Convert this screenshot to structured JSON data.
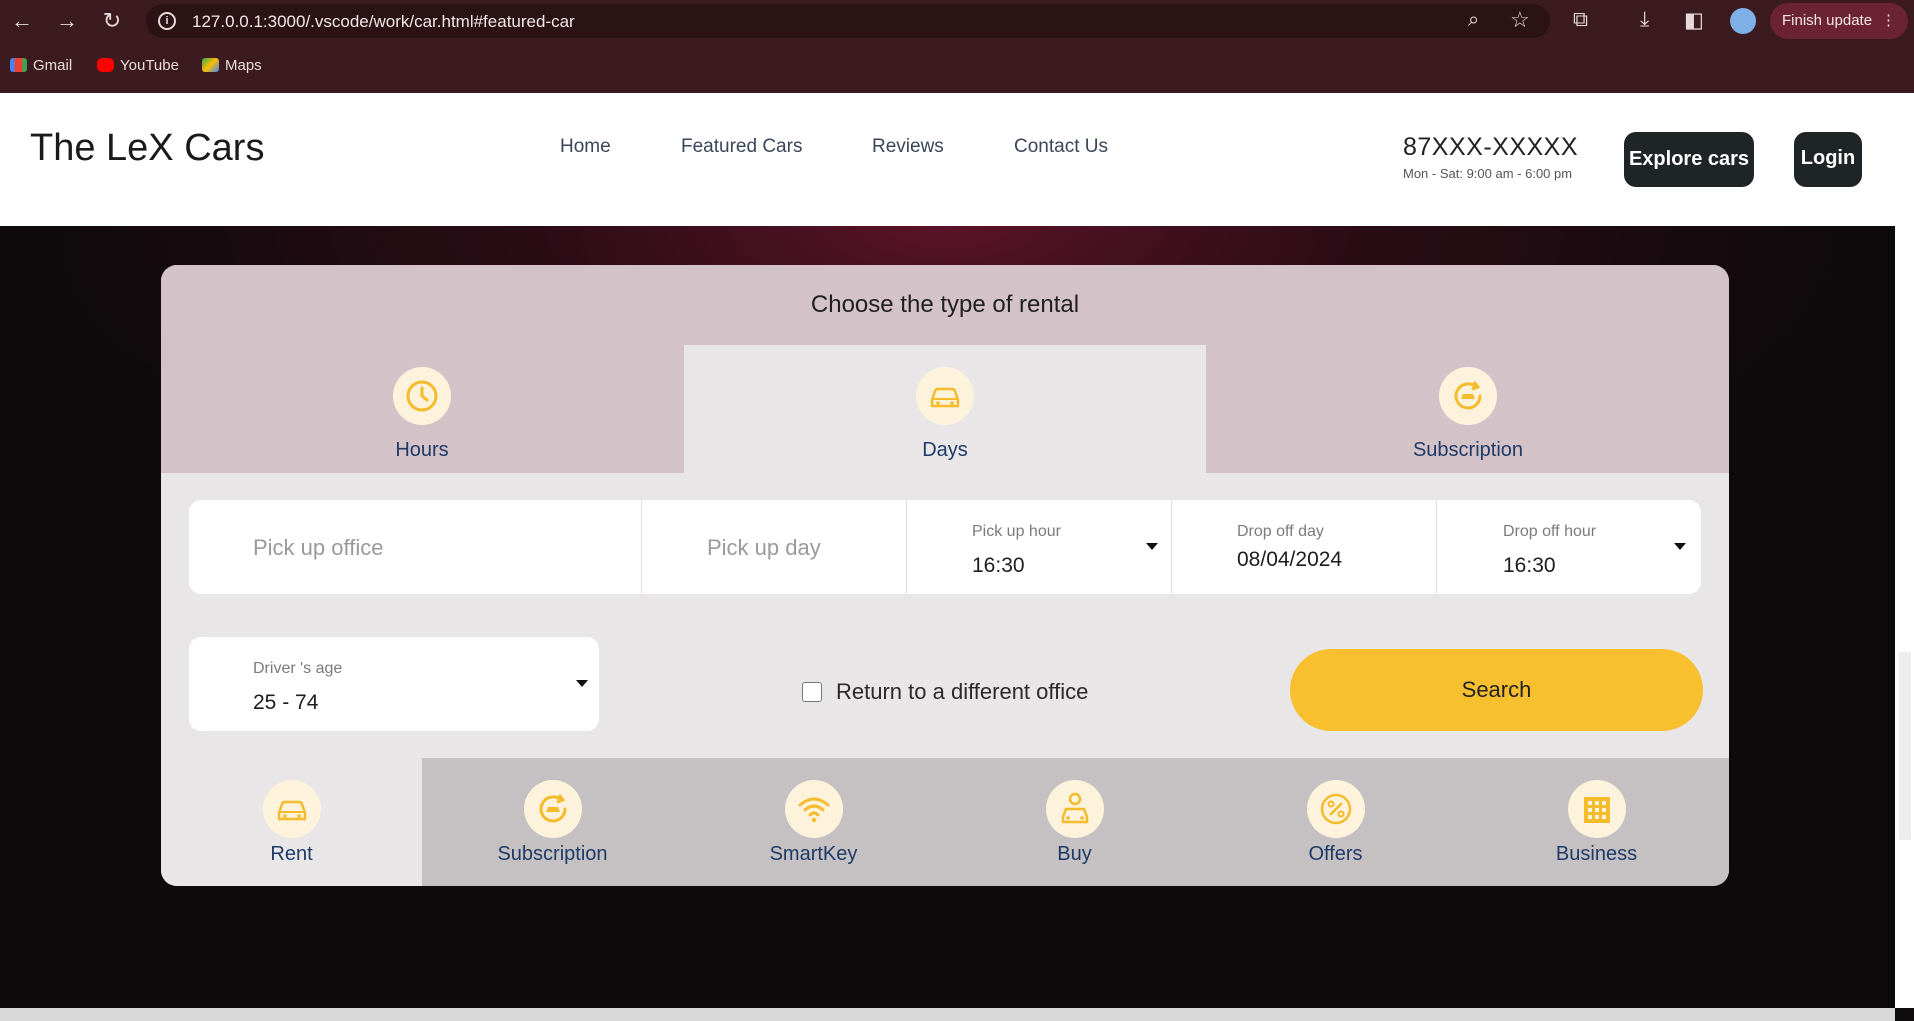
{
  "browser": {
    "url": "127.0.0.1:3000/.vscode/work/car.html#featured-car",
    "finish_update": "Finish update",
    "bookmarks": [
      {
        "label": "Gmail",
        "icon": "gmail-icon"
      },
      {
        "label": "YouTube",
        "icon": "youtube-icon"
      },
      {
        "label": "Maps",
        "icon": "maps-icon"
      }
    ]
  },
  "header": {
    "brand": "The LeX Cars",
    "nav": [
      "Home",
      "Featured Cars",
      "Reviews",
      "Contact Us"
    ],
    "phone": "87XXX-XXXXX",
    "hours": "Mon - Sat: 9:00 am - 6:00 pm",
    "explore_label": "Explore cars",
    "login_label": "Login"
  },
  "rental": {
    "title": "Choose the type of rental",
    "tabs": [
      {
        "label": "Hours",
        "icon": "clock-icon",
        "active": false
      },
      {
        "label": "Days",
        "icon": "car-icon",
        "active": true
      },
      {
        "label": "Subscription",
        "icon": "car-refresh-icon",
        "active": false
      }
    ],
    "fields": {
      "pickup_office_placeholder": "Pick up office",
      "pickup_day_placeholder": "Pick up day",
      "pickup_hour_label": "Pick up hour",
      "pickup_hour_value": "16:30",
      "dropoff_day_label": "Drop off day",
      "dropoff_day_value": "08/04/2024",
      "dropoff_hour_label": "Drop off hour",
      "dropoff_hour_value": "16:30",
      "driver_age_label": "Driver 's age",
      "driver_age_value": "25 - 74"
    },
    "return_checkbox_label": "Return to a different office",
    "return_checked": false,
    "search_label": "Search",
    "bottom_tabs": [
      {
        "label": "Rent",
        "icon": "car-icon",
        "active": true
      },
      {
        "label": "Subscription",
        "icon": "car-refresh-icon",
        "active": false
      },
      {
        "label": "SmartKey",
        "icon": "wifi-icon",
        "active": false
      },
      {
        "label": "Buy",
        "icon": "car-tag-icon",
        "active": false
      },
      {
        "label": "Offers",
        "icon": "percent-icon",
        "active": false
      },
      {
        "label": "Business",
        "icon": "building-icon",
        "active": false
      }
    ]
  },
  "colors": {
    "accent": "#f8bf2e",
    "icon_yellow": "#f4bb2a",
    "icon_bg": "#fdf3dc",
    "tab_text": "#1f3a66",
    "chrome": "#3b1b1f"
  }
}
